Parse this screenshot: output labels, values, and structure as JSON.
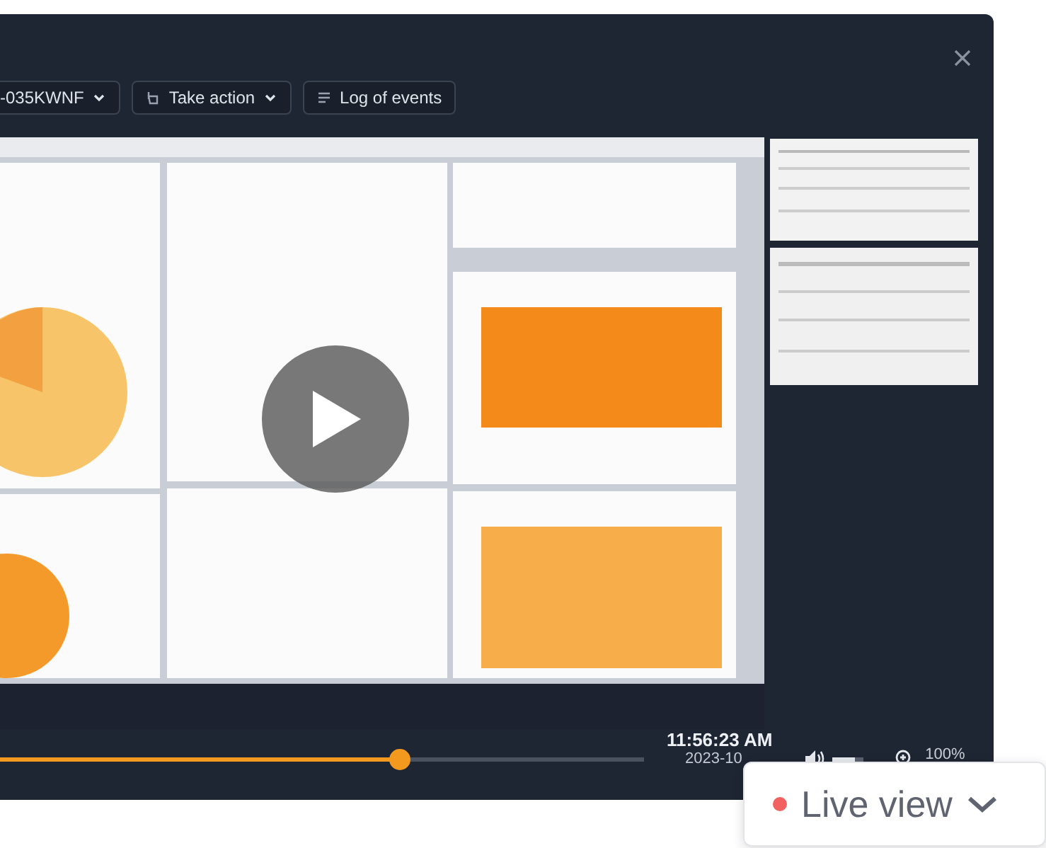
{
  "toolbar": {
    "buttons": [
      {
        "label": "-035KWNF",
        "kind": "dropdown"
      },
      {
        "label": "Take action",
        "kind": "action"
      },
      {
        "label": "Log of events",
        "kind": "log"
      }
    ]
  },
  "player": {
    "progress": {
      "level": 0.62
    },
    "time": "11:56:23 AM",
    "date": "2023-10",
    "volume": {
      "level": 0.75
    },
    "zoom": "100%"
  },
  "live_view": {
    "label": "Live view"
  }
}
